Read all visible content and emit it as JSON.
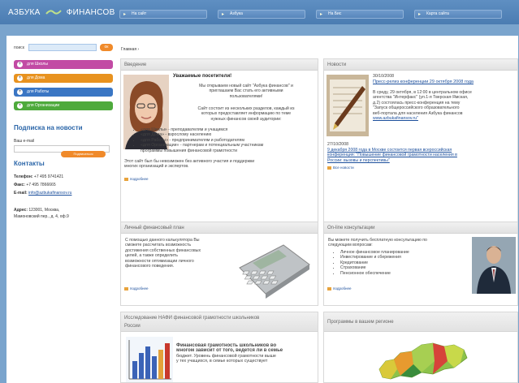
{
  "logo": {
    "left": "АЗБУКА",
    "right": "ФИНАНСОВ"
  },
  "topnav": [
    "На сайт",
    "Азбука",
    "На Бис",
    "Карта сайта"
  ],
  "sidebar": {
    "search_label": "поиск",
    "search_button": "ок",
    "menu": [
      {
        "label": "для Школы",
        "color": "#c24aa4"
      },
      {
        "label": "для Дома",
        "color": "#e8921f"
      },
      {
        "label": "для Работы",
        "color": "#3a76c4"
      },
      {
        "label": "для Организации",
        "color": "#4eaa3c"
      }
    ],
    "subscribe_title": "Подписка на новости",
    "email_label": "Ваш e-mail",
    "subscribe_button": "Подписаться",
    "contacts_title": "Контакты",
    "phone_label": "Телефон:",
    "phone": "+7 495 9741421",
    "fax_label": "Факс:",
    "fax": "+7 495 7866665",
    "email_text_label": "E-mail:",
    "email": "info@azbukafinansov.ru",
    "address_label": "Адрес:",
    "address1": "123001, Москва,",
    "address2": "Мамоновский пер., д. 4, оф.9"
  },
  "breadcrumb": "Главная",
  "intro": {
    "title": "Введение",
    "heading": "Уважаемые посетители!",
    "p1": [
      "Мы открываем новый сайт \"Азбука финансов\" и",
      "приглашаем Вас стать его активными",
      "пользователями!"
    ],
    "p2": [
      "Сайт состоит из нескольких разделов, каждый из",
      "которых предоставляет информацию по темe",
      "нужных финансов своей аудитории:"
    ],
    "bullets": [
      "«для Школы» - преподавателям и учащимся",
      "«для Дома» - взрослому населению",
      "«для Работы» - предпринимателям и работодателям",
      "«для Организации» - партнерам и потенциальным участникам",
      "программы повышения финансовой грамотности"
    ],
    "p3": [
      "Этот сайт был бы невозможен без активного участия и поддержки",
      "многих организаций и экспертов."
    ],
    "more": "подробнее"
  },
  "news": {
    "title": "Новости",
    "date1": "30/10/2008",
    "link1": "Пресс-релиз конференции 29 октября 2008 года",
    "text1": [
      "В среду, 29 октября, в 12:00 в центральном офисе",
      "агентства \"Интерфакс\" (ул.1-я Тверская-Ямская,",
      "д.2) состоялась пресс-конференция на тему",
      "\"Запуск общероссийского образовательного",
      "веб-портала для населения Азбука финансов",
      "www.azbukafinansov.ru\""
    ],
    "date2": "27/10/2008",
    "link2": [
      "9 декабря 2008 года в Москве состоится первая всероссийская",
      "конференция: \"Повышение финансовой грамотности населения в",
      "России: вызовы и перспективы\""
    ],
    "more": "Все новости"
  },
  "calc": {
    "title": "Личный финансовый план",
    "text": [
      "С помощью данного калькулятора Вы",
      "сможете рассчитать возможность",
      "достижения собственных финансовых",
      "целей, а также определить",
      "возможности оптимизации личного",
      "финансового поведения."
    ],
    "more": "подробнее"
  },
  "consult": {
    "title": "On-line консультации",
    "text": [
      "Вы можете получить бесплатную консультацию по",
      "следующим вопросам:"
    ],
    "bullets": [
      "Личное финансовое планирование",
      "Инвестирование и сбережения",
      "Кредитование",
      "Страхование",
      "Пенсионное обеспечение"
    ],
    "more": "подробнее"
  },
  "research": {
    "title": [
      "Исследование НАФИ финансовой грамотности школьников",
      "России"
    ],
    "text": [
      "Финансовая грамотность школьников во",
      "многом зависит от того, ведется ли в семье",
      "бюджет. Уровень финансовой грамотности выше",
      "у тех учащихся, в семье которых существует"
    ]
  },
  "regions": {
    "title": "Программы в вашем регионе"
  },
  "colors": {
    "accent": "#2a65a8",
    "bg": "#7aa4cd",
    "orange": "#f08a2a"
  }
}
